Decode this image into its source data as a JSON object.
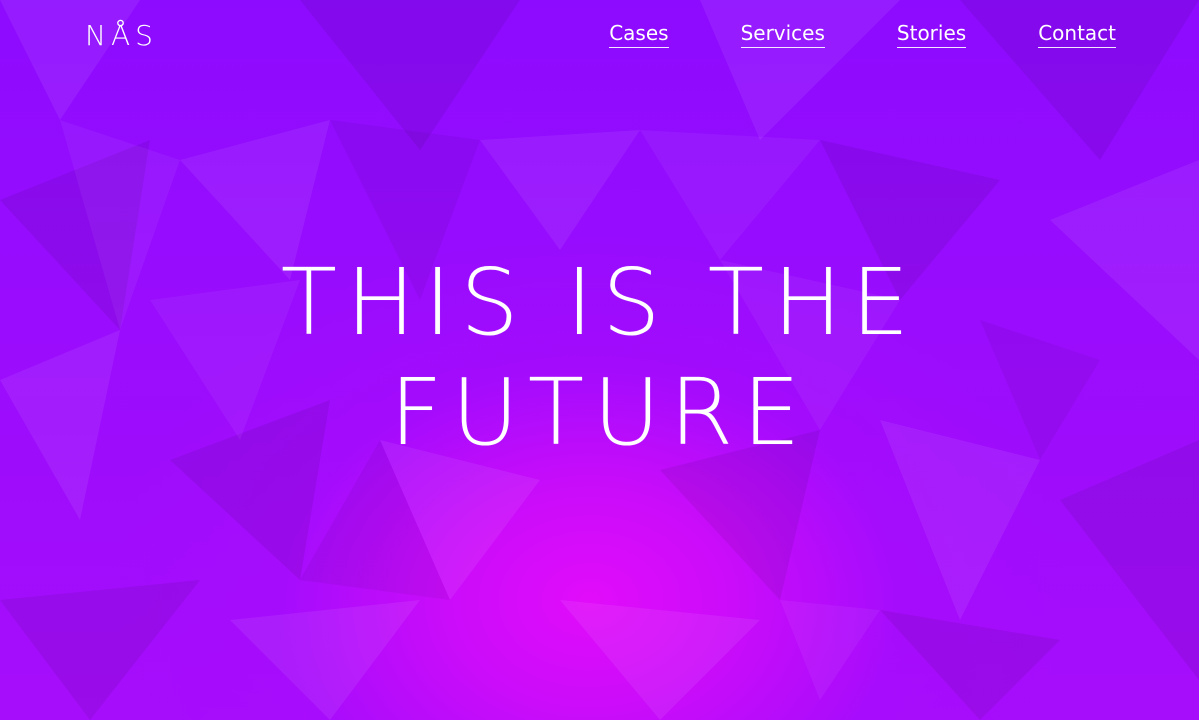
{
  "brand": {
    "logo_text": "NÅS"
  },
  "nav": {
    "items": [
      {
        "label": "Cases"
      },
      {
        "label": "Services"
      },
      {
        "label": "Stories"
      },
      {
        "label": "Contact"
      }
    ]
  },
  "hero": {
    "line1": "THIS IS THE",
    "line2": "FUTURE"
  },
  "colors": {
    "background_primary": "#8d0bff",
    "background_glow": "#e10cfa",
    "text": "#ffffff"
  }
}
